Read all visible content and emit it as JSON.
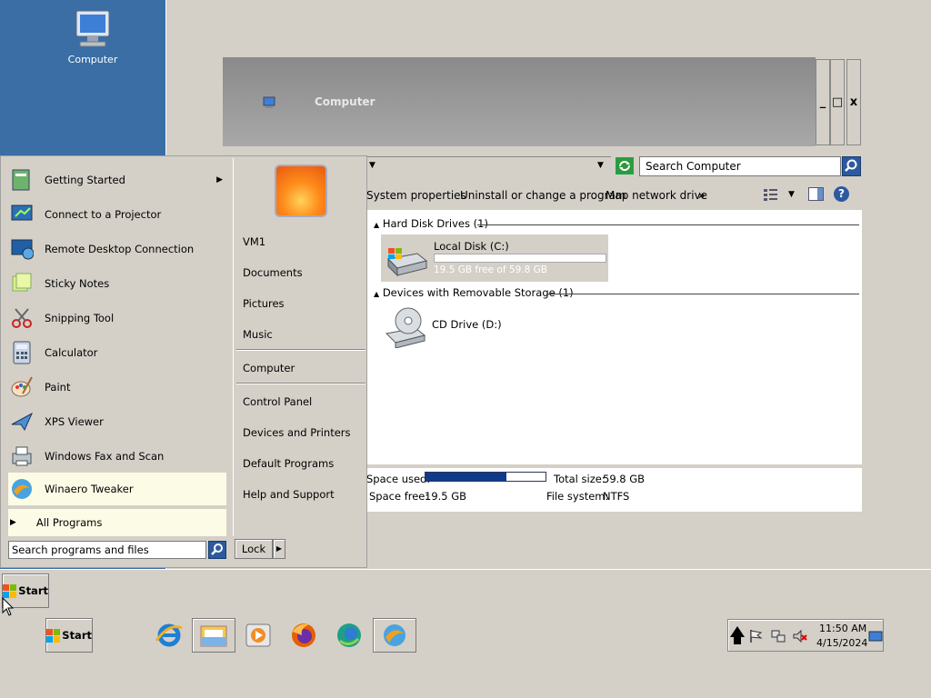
{
  "desktop": {
    "icon_label": "Computer"
  },
  "window": {
    "title": "Computer",
    "search_placeholder": "Search Computer",
    "toolbar": {
      "system_properties": "System properties",
      "uninstall": "Uninstall or change a program",
      "map_drive": "Map network drive",
      "more": "»"
    },
    "groups": {
      "hdd_header": "Hard Disk Drives (1)",
      "removable_header": "Devices with Removable Storage (1)"
    },
    "drives": {
      "c_name": "Local Disk (C:)",
      "c_free": "19.5 GB free of 59.8 GB",
      "c_used_fraction": 0.674,
      "d_name": "CD Drive (D:)"
    },
    "details": {
      "space_used_label": "Space used:",
      "space_free_label": "Space free:",
      "space_free_value": "19.5 GB",
      "total_size_label": "Total size:",
      "total_size_value": "59.8 GB",
      "fs_label": "File system:",
      "fs_value": "NTFS"
    },
    "controls": {
      "minimize": "_",
      "maximize": "□",
      "close": "x"
    }
  },
  "start_menu": {
    "programs": [
      {
        "label": "Getting Started",
        "icon": "getting-started-icon"
      },
      {
        "label": "Connect to a Projector",
        "icon": "projector-icon"
      },
      {
        "label": "Remote Desktop Connection",
        "icon": "remote-desktop-icon"
      },
      {
        "label": "Sticky Notes",
        "icon": "sticky-notes-icon"
      },
      {
        "label": "Snipping Tool",
        "icon": "snipping-tool-icon"
      },
      {
        "label": "Calculator",
        "icon": "calculator-icon"
      },
      {
        "label": "Paint",
        "icon": "paint-icon"
      },
      {
        "label": "XPS Viewer",
        "icon": "xps-viewer-icon"
      },
      {
        "label": "Windows Fax and Scan",
        "icon": "fax-scan-icon"
      },
      {
        "label": "Winaero Tweaker",
        "icon": "winaero-icon"
      }
    ],
    "all_programs": "All Programs",
    "search_placeholder": "Search programs and files",
    "right": {
      "user": "VM1",
      "documents": "Documents",
      "pictures": "Pictures",
      "music": "Music",
      "computer": "Computer",
      "control_panel": "Control Panel",
      "devices": "Devices and Printers",
      "default_programs": "Default Programs",
      "help": "Help and Support"
    },
    "lock_label": "Lock"
  },
  "taskbar": {
    "start_label": "Start",
    "start_label_2": "Start",
    "time": "11:50 AM",
    "date": "4/15/2024"
  }
}
